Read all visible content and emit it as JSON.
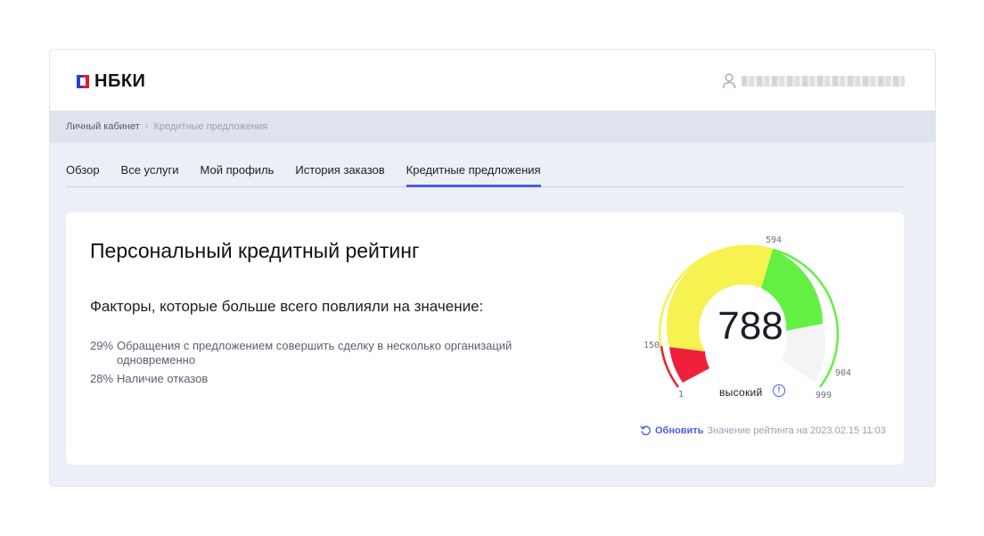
{
  "header": {
    "logo_text": "НБКИ",
    "user_icon": "user-icon"
  },
  "breadcrumb": {
    "items": [
      "Личный кабинет",
      "Кредитные предложения"
    ],
    "separator": "›"
  },
  "tabs": [
    {
      "label": "Обзор",
      "active": false
    },
    {
      "label": "Все услуги",
      "active": false
    },
    {
      "label": "Мой профиль",
      "active": false
    },
    {
      "label": "История заказов",
      "active": false
    },
    {
      "label": "Кредитные предложения",
      "active": true
    }
  ],
  "card": {
    "title": "Персональный кредитный рейтинг",
    "factors_title": "Факторы, которые больше всего повлияли на значение:",
    "factors": [
      {
        "percent": "29%",
        "text": "Обращения с предложением совершить сделку в несколько организаций одновременно"
      },
      {
        "percent": "28%",
        "text": "Наличие отказов"
      }
    ]
  },
  "gauge": {
    "score": "788",
    "level": "высокий",
    "min": 1,
    "max": 999,
    "scale_labels": {
      "l1": "1",
      "l150": "150",
      "l594": "594",
      "l904": "904",
      "l999": "999"
    },
    "colors": {
      "red": "#f0203a",
      "yellow": "#f6f250",
      "green": "#63f043",
      "white": "#f7f8fa"
    },
    "info_icon": "info-icon"
  },
  "refresh": {
    "icon": "refresh-icon",
    "link_label": "Обновить",
    "date_text": "Значение рейтинга на 2023.02.15 11:03"
  }
}
